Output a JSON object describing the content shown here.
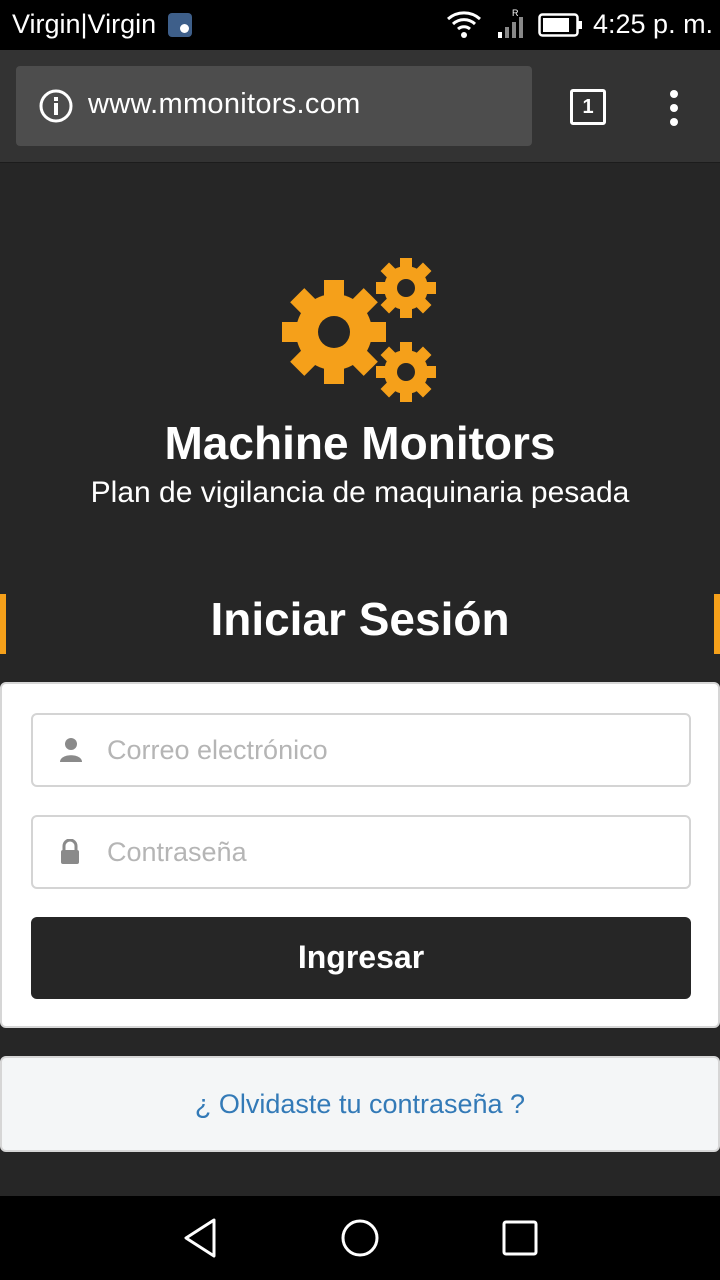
{
  "status_bar": {
    "carrier": "Virgin|Virgin",
    "time": "4:25 p. m.",
    "signal_badge": "R"
  },
  "browser": {
    "url": "www.mmonitors.com",
    "tab_count": "1"
  },
  "brand": {
    "title": "Machine Monitors",
    "subtitle": "Plan de vigilancia de maquinaria pesada",
    "logo_color": "#f5a01a"
  },
  "login": {
    "heading": "Iniciar Sesión",
    "email_placeholder": "Correo electrónico",
    "password_placeholder": "Contraseña",
    "submit_label": "Ingresar",
    "forgot_link": "¿ Olvidaste tu contraseña ?"
  },
  "colors": {
    "background": "#262626",
    "accent": "#f5a01a",
    "link": "#337ab7"
  },
  "icons": {
    "email_field": "user-icon",
    "password_field": "lock-icon",
    "logo": "gears-icon"
  }
}
